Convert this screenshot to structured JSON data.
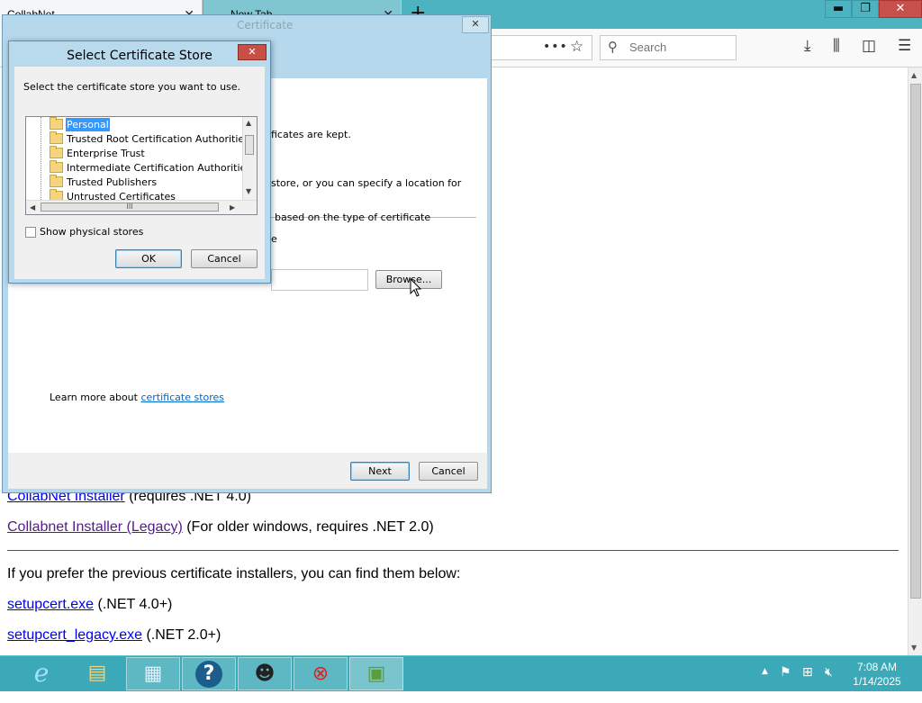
{
  "browser": {
    "tabs": [
      {
        "title": "CollabNet"
      },
      {
        "title": "New Tab"
      }
    ],
    "search_placeholder": "Search",
    "window_buttons": {
      "minimize": "▬",
      "restore": "❐",
      "close": "✕"
    }
  },
  "page": {
    "partial_link": "CollabNet Installer",
    "partial_link_note": "(requires .NET 4.0)",
    "legacy_link": "Collabnet Installer (Legacy)",
    "legacy_note": "(For older windows, requires .NET 2.0)",
    "prev_text": "If you prefer the previous certificate installers, you can find them below:",
    "setupcert_link": "setupcert.exe",
    "setupcert_note": "(.NET 4.0+)",
    "setupcert_legacy_link": "setupcert_legacy.exe",
    "setupcert_legacy_note": "(.NET 2.0+)"
  },
  "wizard": {
    "title_partial": "Certificate",
    "close_label": "✕",
    "text_kept": "ficates are kept.",
    "text_store": "store, or you can specify a location for",
    "text_based": "based on the type of certificate",
    "text_e": "e",
    "browse_label": "Browse...",
    "learn_more_text": "Learn more about ",
    "learn_more_link": "certificate stores",
    "next_label": "Next",
    "cancel_label": "Cancel"
  },
  "select_store": {
    "title": "Select Certificate Store",
    "close_label": "✕",
    "prompt": "Select the certificate store you want to use.",
    "stores": [
      "Personal",
      "Trusted Root Certification Authorities",
      "Enterprise Trust",
      "Intermediate Certification Authorities",
      "Trusted Publishers",
      "Untrusted Certificates"
    ],
    "selected_store": "Personal",
    "show_physical_label": "Show physical stores",
    "show_physical_checked": false,
    "ok_label": "OK",
    "cancel_label": "Cancel",
    "scroll_grip": "III"
  },
  "taskbar": {
    "items": [
      {
        "name": "internet-explorer",
        "glyph": "e"
      },
      {
        "name": "file-explorer",
        "glyph": "▤"
      },
      {
        "name": "server-manager",
        "glyph": "▦"
      },
      {
        "name": "help",
        "glyph": "?"
      },
      {
        "name": "raccoon-app",
        "glyph": "☻"
      },
      {
        "name": "certificate-error-app",
        "glyph": "⊗"
      },
      {
        "name": "certificate-wizard-app",
        "glyph": "▣"
      }
    ],
    "time": "7:08 AM",
    "date": "1/14/2025"
  }
}
